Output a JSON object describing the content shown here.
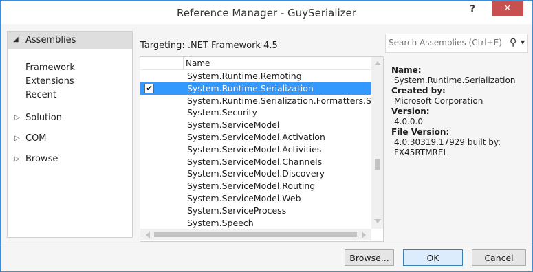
{
  "window": {
    "title": "Reference Manager - GuySerializer",
    "help_label": "?",
    "close_label": "✕"
  },
  "sidebar": {
    "header": "Assemblies",
    "items": [
      {
        "label": "Framework",
        "selected": true
      },
      {
        "label": "Extensions"
      },
      {
        "label": "Recent"
      }
    ],
    "groups": [
      {
        "label": "Solution"
      },
      {
        "label": "COM"
      },
      {
        "label": "Browse"
      }
    ]
  },
  "targeting": "Targeting: .NET Framework 4.5",
  "list": {
    "column_name": "Name",
    "rows": [
      {
        "name": "System.Runtime.Remoting",
        "checked": false,
        "selected": false
      },
      {
        "name": "System.Runtime.Serialization",
        "checked": true,
        "selected": true
      },
      {
        "name": "System.Runtime.Serialization.Formatters.Soap",
        "checked": false,
        "selected": false
      },
      {
        "name": "System.Security",
        "checked": false,
        "selected": false
      },
      {
        "name": "System.ServiceModel",
        "checked": false,
        "selected": false
      },
      {
        "name": "System.ServiceModel.Activation",
        "checked": false,
        "selected": false
      },
      {
        "name": "System.ServiceModel.Activities",
        "checked": false,
        "selected": false
      },
      {
        "name": "System.ServiceModel.Channels",
        "checked": false,
        "selected": false
      },
      {
        "name": "System.ServiceModel.Discovery",
        "checked": false,
        "selected": false
      },
      {
        "name": "System.ServiceModel.Routing",
        "checked": false,
        "selected": false
      },
      {
        "name": "System.ServiceModel.Web",
        "checked": false,
        "selected": false
      },
      {
        "name": "System.ServiceProcess",
        "checked": false,
        "selected": false
      },
      {
        "name": "System.Speech",
        "checked": false,
        "selected": false
      }
    ]
  },
  "search": {
    "placeholder": "Search Assemblies (Ctrl+E)"
  },
  "details": {
    "name_label": "Name:",
    "name_value": "System.Runtime.Serialization",
    "created_label": "Created by:",
    "created_value": "Microsoft Corporation",
    "version_label": "Version:",
    "version_value": "4.0.0.0",
    "file_version_label": "File Version:",
    "file_version_value": "4.0.30319.17929 built by:",
    "file_version_extra": "FX45RTMREL"
  },
  "buttons": {
    "browse": "Browse...",
    "ok": "OK",
    "cancel": "Cancel"
  },
  "colors": {
    "selection": "#3399ff",
    "close_button": "#c75050",
    "window_border": "#3c8fd4"
  }
}
